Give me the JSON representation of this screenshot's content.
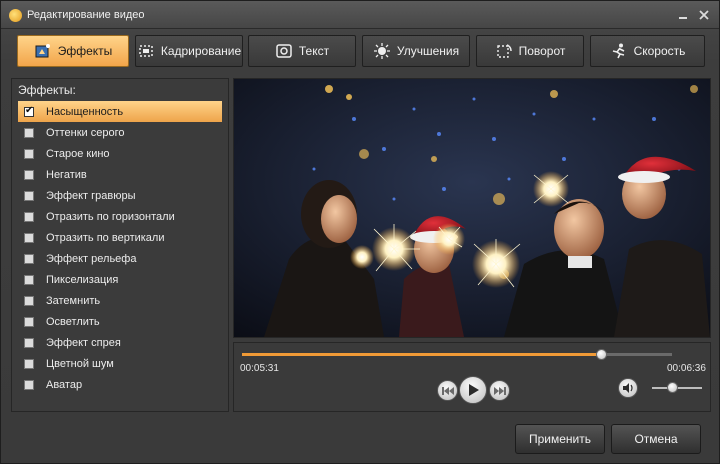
{
  "window": {
    "title": "Редактирование видео",
    "icon": "app-logo-icon"
  },
  "tabs": [
    {
      "label": "Эффекты",
      "icon": "effects-icon",
      "active": true
    },
    {
      "label": "Кадрирование",
      "icon": "crop-icon",
      "active": false
    },
    {
      "label": "Текст",
      "icon": "text-icon",
      "active": false
    },
    {
      "label": "Улучшения",
      "icon": "brightness-icon",
      "active": false
    },
    {
      "label": "Поворот",
      "icon": "rotate-icon",
      "active": false
    },
    {
      "label": "Скорость",
      "icon": "running-man-icon",
      "active": false
    }
  ],
  "effects_panel": {
    "heading": "Эффекты:",
    "items": [
      {
        "label": "Насыщенность",
        "checked": true
      },
      {
        "label": "Оттенки серого",
        "checked": false
      },
      {
        "label": "Старое кино",
        "checked": false
      },
      {
        "label": "Негатив",
        "checked": false
      },
      {
        "label": "Эффект гравюры",
        "checked": false
      },
      {
        "label": "Отразить по горизонтали",
        "checked": false
      },
      {
        "label": "Отразить по вертикали",
        "checked": false
      },
      {
        "label": "Эффект рельефа",
        "checked": false
      },
      {
        "label": "Пикселизация",
        "checked": false
      },
      {
        "label": "Затемнить",
        "checked": false
      },
      {
        "label": "Осветлить",
        "checked": false
      },
      {
        "label": "Эффект спрея",
        "checked": false
      },
      {
        "label": "Цветной шум",
        "checked": false
      },
      {
        "label": "Аватар",
        "checked": false
      }
    ]
  },
  "player": {
    "current_time": "00:05:31",
    "total_time": "00:06:36",
    "progress": 0.836,
    "volume": 0.4,
    "buttons": {
      "prev": "skip-back-icon",
      "play": "play-icon",
      "next": "skip-forward-icon",
      "volume": "speaker-icon"
    }
  },
  "footer": {
    "apply_label": "Применить",
    "cancel_label": "Отмена"
  },
  "colors": {
    "accent": "#f2a54a",
    "accent_light": "#ffd48a",
    "progress": "#f09a36"
  }
}
